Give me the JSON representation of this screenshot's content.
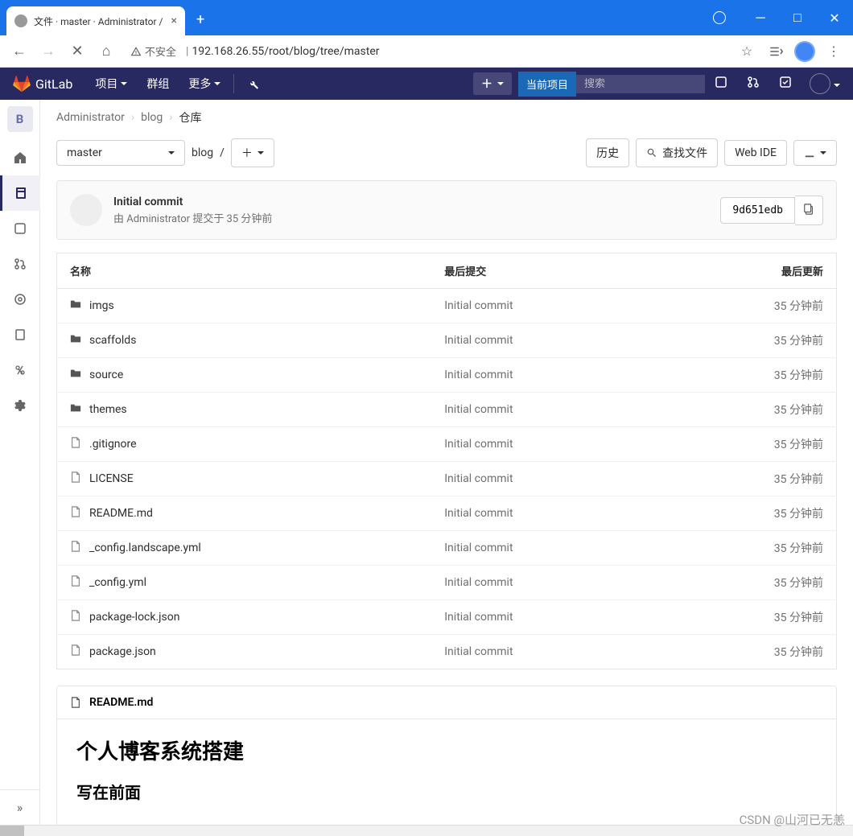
{
  "browser": {
    "tab_title": "文件 · master · Administrator / ",
    "url_insecure": "不安全",
    "url_host": "192.168.26.55",
    "url_path": "/root/blog/tree/master"
  },
  "gitlab_header": {
    "brand": "GitLab",
    "nav": {
      "projects": "项目",
      "groups": "群组",
      "more": "更多"
    },
    "current_project_badge": "当前项目",
    "search_placeholder": "搜索"
  },
  "sidebar": {
    "project_letter": "B"
  },
  "breadcrumb": {
    "owner": "Administrator",
    "project": "blog",
    "current": "仓库"
  },
  "tree_controls": {
    "branch": "master",
    "path": "blog",
    "path_sep": "/",
    "history": "历史",
    "find_file": "查找文件",
    "web_ide": "Web IDE"
  },
  "last_commit": {
    "title": "Initial commit",
    "byline_prefix": "由 ",
    "author": "Administrator",
    "byline_mid": " 提交于 ",
    "time": "35 分钟前",
    "sha": "9d651edb"
  },
  "table": {
    "headers": {
      "name": "名称",
      "last_commit": "最后提交",
      "last_update": "最后更新"
    },
    "rows": [
      {
        "type": "folder",
        "name": "imgs",
        "commit": "Initial commit",
        "updated": "35 分钟前"
      },
      {
        "type": "folder",
        "name": "scaffolds",
        "commit": "Initial commit",
        "updated": "35 分钟前"
      },
      {
        "type": "folder",
        "name": "source",
        "commit": "Initial commit",
        "updated": "35 分钟前"
      },
      {
        "type": "folder",
        "name": "themes",
        "commit": "Initial commit",
        "updated": "35 分钟前"
      },
      {
        "type": "file",
        "name": ".gitignore",
        "commit": "Initial commit",
        "updated": "35 分钟前"
      },
      {
        "type": "file",
        "name": "LICENSE",
        "commit": "Initial commit",
        "updated": "35 分钟前"
      },
      {
        "type": "file",
        "name": "README.md",
        "commit": "Initial commit",
        "updated": "35 分钟前"
      },
      {
        "type": "file",
        "name": "_config.landscape.yml",
        "commit": "Initial commit",
        "updated": "35 分钟前"
      },
      {
        "type": "file",
        "name": "_config.yml",
        "commit": "Initial commit",
        "updated": "35 分钟前"
      },
      {
        "type": "file",
        "name": "package-lock.json",
        "commit": "Initial commit",
        "updated": "35 分钟前"
      },
      {
        "type": "file",
        "name": "package.json",
        "commit": "Initial commit",
        "updated": "35 分钟前"
      }
    ]
  },
  "readme": {
    "filename": "README.md",
    "h1": "个人博客系统搭建",
    "h2": "写在前面"
  },
  "watermark": "CSDN @山河已无恙"
}
